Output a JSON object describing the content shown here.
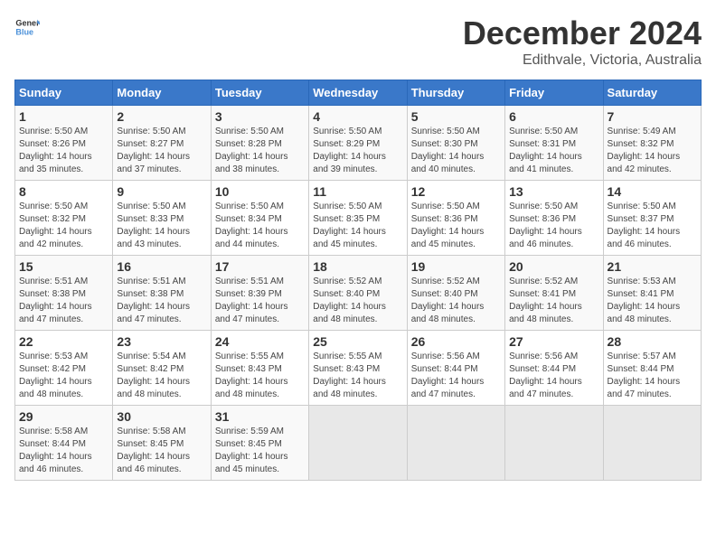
{
  "header": {
    "logo_general": "General",
    "logo_blue": "Blue",
    "main_title": "December 2024",
    "subtitle": "Edithvale, Victoria, Australia"
  },
  "days_of_week": [
    "Sunday",
    "Monday",
    "Tuesday",
    "Wednesday",
    "Thursday",
    "Friday",
    "Saturday"
  ],
  "weeks": [
    [
      {
        "day": "1",
        "detail": "Sunrise: 5:50 AM\nSunset: 8:26 PM\nDaylight: 14 hours\nand 35 minutes."
      },
      {
        "day": "2",
        "detail": "Sunrise: 5:50 AM\nSunset: 8:27 PM\nDaylight: 14 hours\nand 37 minutes."
      },
      {
        "day": "3",
        "detail": "Sunrise: 5:50 AM\nSunset: 8:28 PM\nDaylight: 14 hours\nand 38 minutes."
      },
      {
        "day": "4",
        "detail": "Sunrise: 5:50 AM\nSunset: 8:29 PM\nDaylight: 14 hours\nand 39 minutes."
      },
      {
        "day": "5",
        "detail": "Sunrise: 5:50 AM\nSunset: 8:30 PM\nDaylight: 14 hours\nand 40 minutes."
      },
      {
        "day": "6",
        "detail": "Sunrise: 5:50 AM\nSunset: 8:31 PM\nDaylight: 14 hours\nand 41 minutes."
      },
      {
        "day": "7",
        "detail": "Sunrise: 5:49 AM\nSunset: 8:32 PM\nDaylight: 14 hours\nand 42 minutes."
      }
    ],
    [
      {
        "day": "8",
        "detail": "Sunrise: 5:50 AM\nSunset: 8:32 PM\nDaylight: 14 hours\nand 42 minutes."
      },
      {
        "day": "9",
        "detail": "Sunrise: 5:50 AM\nSunset: 8:33 PM\nDaylight: 14 hours\nand 43 minutes."
      },
      {
        "day": "10",
        "detail": "Sunrise: 5:50 AM\nSunset: 8:34 PM\nDaylight: 14 hours\nand 44 minutes."
      },
      {
        "day": "11",
        "detail": "Sunrise: 5:50 AM\nSunset: 8:35 PM\nDaylight: 14 hours\nand 45 minutes."
      },
      {
        "day": "12",
        "detail": "Sunrise: 5:50 AM\nSunset: 8:36 PM\nDaylight: 14 hours\nand 45 minutes."
      },
      {
        "day": "13",
        "detail": "Sunrise: 5:50 AM\nSunset: 8:36 PM\nDaylight: 14 hours\nand 46 minutes."
      },
      {
        "day": "14",
        "detail": "Sunrise: 5:50 AM\nSunset: 8:37 PM\nDaylight: 14 hours\nand 46 minutes."
      }
    ],
    [
      {
        "day": "15",
        "detail": "Sunrise: 5:51 AM\nSunset: 8:38 PM\nDaylight: 14 hours\nand 47 minutes."
      },
      {
        "day": "16",
        "detail": "Sunrise: 5:51 AM\nSunset: 8:38 PM\nDaylight: 14 hours\nand 47 minutes."
      },
      {
        "day": "17",
        "detail": "Sunrise: 5:51 AM\nSunset: 8:39 PM\nDaylight: 14 hours\nand 47 minutes."
      },
      {
        "day": "18",
        "detail": "Sunrise: 5:52 AM\nSunset: 8:40 PM\nDaylight: 14 hours\nand 48 minutes."
      },
      {
        "day": "19",
        "detail": "Sunrise: 5:52 AM\nSunset: 8:40 PM\nDaylight: 14 hours\nand 48 minutes."
      },
      {
        "day": "20",
        "detail": "Sunrise: 5:52 AM\nSunset: 8:41 PM\nDaylight: 14 hours\nand 48 minutes."
      },
      {
        "day": "21",
        "detail": "Sunrise: 5:53 AM\nSunset: 8:41 PM\nDaylight: 14 hours\nand 48 minutes."
      }
    ],
    [
      {
        "day": "22",
        "detail": "Sunrise: 5:53 AM\nSunset: 8:42 PM\nDaylight: 14 hours\nand 48 minutes."
      },
      {
        "day": "23",
        "detail": "Sunrise: 5:54 AM\nSunset: 8:42 PM\nDaylight: 14 hours\nand 48 minutes."
      },
      {
        "day": "24",
        "detail": "Sunrise: 5:55 AM\nSunset: 8:43 PM\nDaylight: 14 hours\nand 48 minutes."
      },
      {
        "day": "25",
        "detail": "Sunrise: 5:55 AM\nSunset: 8:43 PM\nDaylight: 14 hours\nand 48 minutes."
      },
      {
        "day": "26",
        "detail": "Sunrise: 5:56 AM\nSunset: 8:44 PM\nDaylight: 14 hours\nand 47 minutes."
      },
      {
        "day": "27",
        "detail": "Sunrise: 5:56 AM\nSunset: 8:44 PM\nDaylight: 14 hours\nand 47 minutes."
      },
      {
        "day": "28",
        "detail": "Sunrise: 5:57 AM\nSunset: 8:44 PM\nDaylight: 14 hours\nand 47 minutes."
      }
    ],
    [
      {
        "day": "29",
        "detail": "Sunrise: 5:58 AM\nSunset: 8:44 PM\nDaylight: 14 hours\nand 46 minutes."
      },
      {
        "day": "30",
        "detail": "Sunrise: 5:58 AM\nSunset: 8:45 PM\nDaylight: 14 hours\nand 46 minutes."
      },
      {
        "day": "31",
        "detail": "Sunrise: 5:59 AM\nSunset: 8:45 PM\nDaylight: 14 hours\nand 45 minutes."
      },
      {
        "day": "",
        "detail": ""
      },
      {
        "day": "",
        "detail": ""
      },
      {
        "day": "",
        "detail": ""
      },
      {
        "day": "",
        "detail": ""
      }
    ]
  ]
}
